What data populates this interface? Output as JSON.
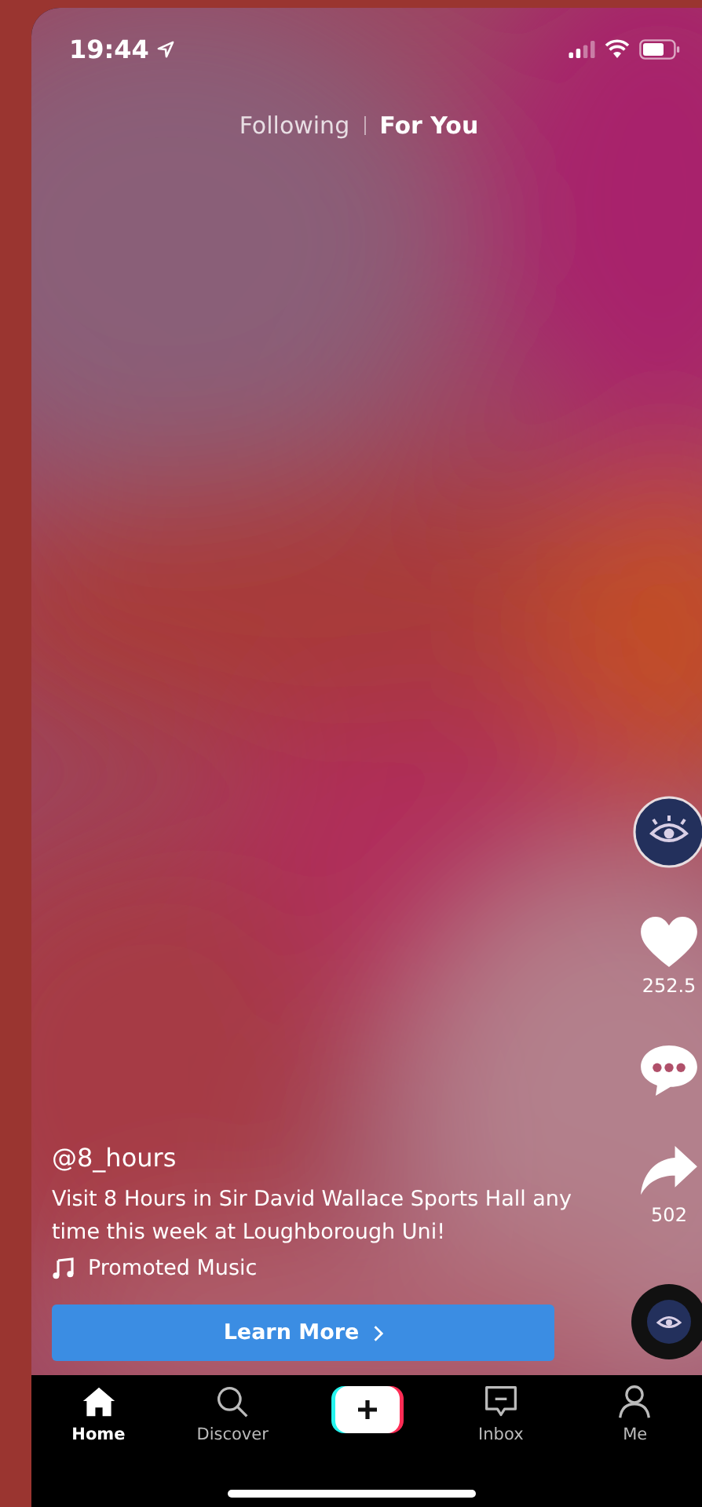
{
  "status_bar": {
    "time": "19:44"
  },
  "feed_tabs": [
    {
      "label": "Following",
      "selected": false
    },
    {
      "label": "For You",
      "selected": true
    }
  ],
  "actions": [
    {
      "kind": "avatar"
    },
    {
      "kind": "like",
      "count": "252.5"
    },
    {
      "kind": "comment"
    },
    {
      "kind": "share",
      "count": "502"
    },
    {
      "kind": "disc"
    }
  ],
  "caption": {
    "username": "@8_hours",
    "text": "Visit 8 Hours in Sir David Wallace Sports Hall any time this week at Loughborough Uni!",
    "music": "Promoted Music"
  },
  "cta": {
    "label": "Learn More"
  },
  "nav": [
    {
      "kind": "home",
      "label": "Home",
      "selected": true
    },
    {
      "kind": "discover",
      "label": "Discover",
      "selected": false
    },
    {
      "kind": "create",
      "selected": false
    },
    {
      "kind": "inbox",
      "label": "Inbox",
      "selected": false
    },
    {
      "kind": "me",
      "label": "Me",
      "selected": false
    }
  ]
}
